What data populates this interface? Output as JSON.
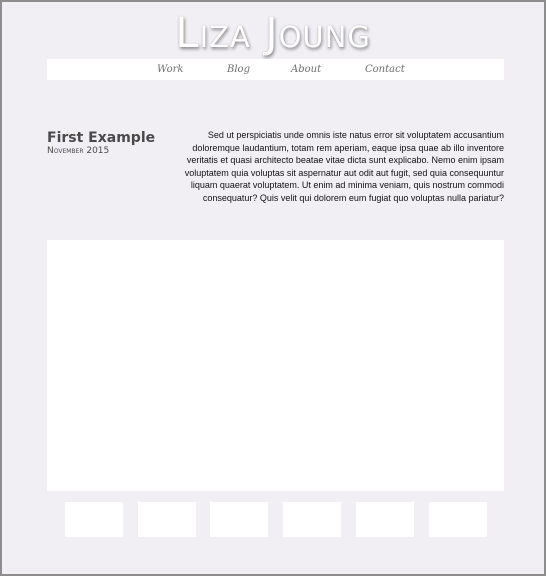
{
  "site": {
    "title": "Liza Joung"
  },
  "nav": {
    "items": [
      {
        "label": "Work"
      },
      {
        "label": "Blog"
      },
      {
        "label": "About"
      },
      {
        "label": "Contact"
      }
    ]
  },
  "post": {
    "title": "First Example",
    "date": "November 2015",
    "body": "Sed ut perspiciatis unde omnis iste natus error sit voluptatem accusantium doloremque laudantium, totam rem aperiam, eaque ipsa quae ab illo inventore veritatis et quasi architecto beatae vitae dicta sunt explicabo. Nemo enim ipsam voluptatem quia voluptas sit aspernatur aut odit aut fugit, sed quia consequuntur liquam quaerat voluptatem. Ut enim ad minima veniam, quis nostrum commodi consequatur? Quis velit qui dolorem eum fugiat quo voluptas nulla pariatur?"
  },
  "colors": {
    "page_background": "#f1eff4",
    "panel": "#ffffff",
    "frame_border": "#8d8d8d"
  }
}
